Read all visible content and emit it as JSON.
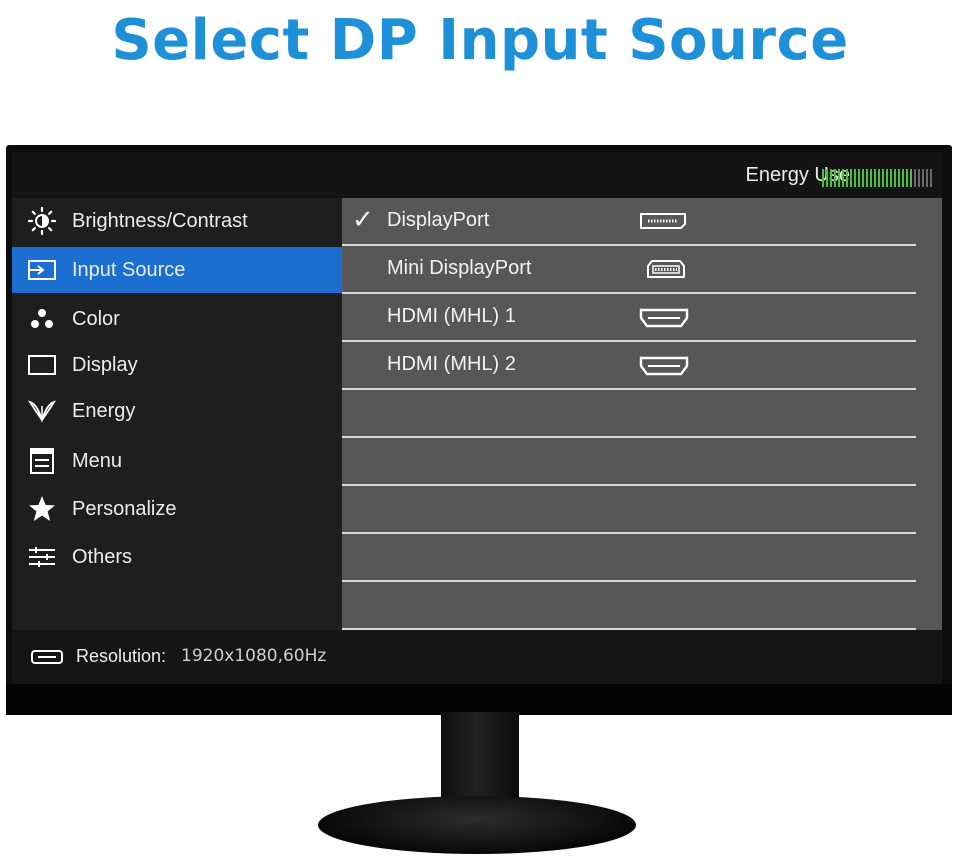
{
  "headline": "Select DP Input Source",
  "osd": {
    "energy_label": "Energy Use",
    "energy_level": {
      "active_bars": 23,
      "total_bars": 28
    },
    "menu": [
      {
        "label": "Brightness/Contrast",
        "icon": "brightness-icon",
        "active": false
      },
      {
        "label": "Input Source",
        "icon": "input-source-icon",
        "active": true
      },
      {
        "label": "Color",
        "icon": "color-icon",
        "active": false
      },
      {
        "label": "Display",
        "icon": "display-icon",
        "active": false
      },
      {
        "label": "Energy",
        "icon": "energy-leaf-icon",
        "active": false
      },
      {
        "label": "Menu",
        "icon": "menu-icon",
        "active": false
      },
      {
        "label": "Personalize",
        "icon": "star-icon",
        "active": false
      },
      {
        "label": "Others",
        "icon": "sliders-icon",
        "active": false
      }
    ],
    "inputs": [
      {
        "label": "DisplayPort",
        "selected": true,
        "port_icon": "displayport-icon"
      },
      {
        "label": "Mini DisplayPort",
        "selected": false,
        "port_icon": "mini-displayport-icon"
      },
      {
        "label": "HDMI (MHL) 1",
        "selected": false,
        "port_icon": "hdmi-icon"
      },
      {
        "label": "HDMI (MHL) 2",
        "selected": false,
        "port_icon": "hdmi-icon"
      }
    ],
    "checkmark": "✓",
    "resolution_label": "Resolution:",
    "resolution_value": "1920x1080,60Hz"
  },
  "colors": {
    "headline": "#1e90d8",
    "active_menu": "#1b6fd1",
    "energy_green": "#4cbf3a"
  }
}
